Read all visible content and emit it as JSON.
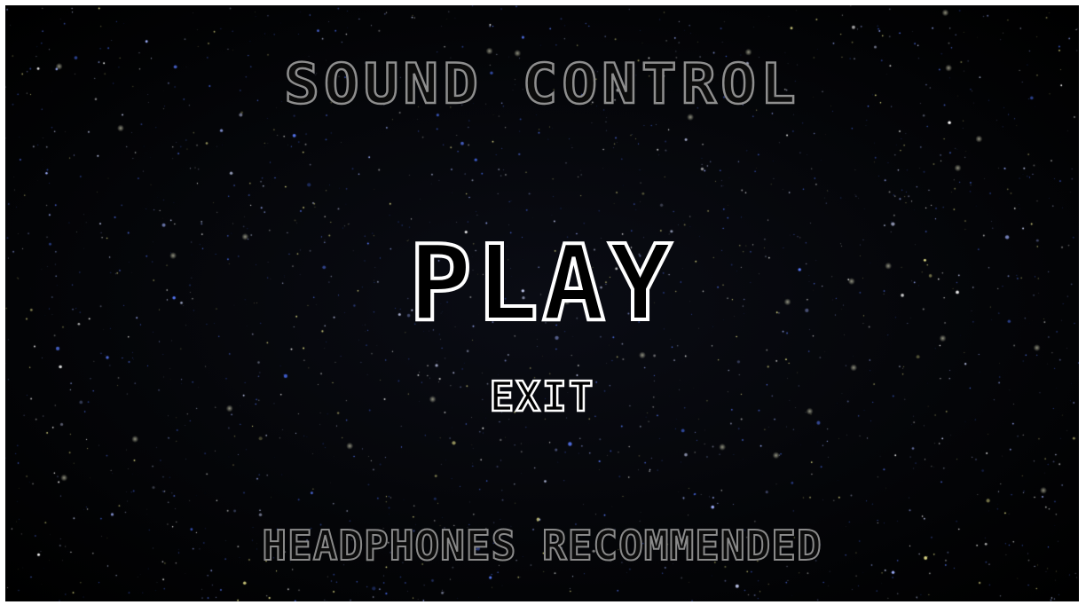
{
  "menu": {
    "title": "SOUND CONTROL",
    "play_label": "PLAY",
    "exit_label": "EXIT",
    "footer_note": "HEADPHONES RECOMMENDED"
  },
  "colors": {
    "background": "#000000",
    "title": "#8e8e8e",
    "primary_button": "#ffffff",
    "footer": "#8a8a8a",
    "star_blue": "#5a7cff",
    "star_yellow": "#e8e48c"
  }
}
